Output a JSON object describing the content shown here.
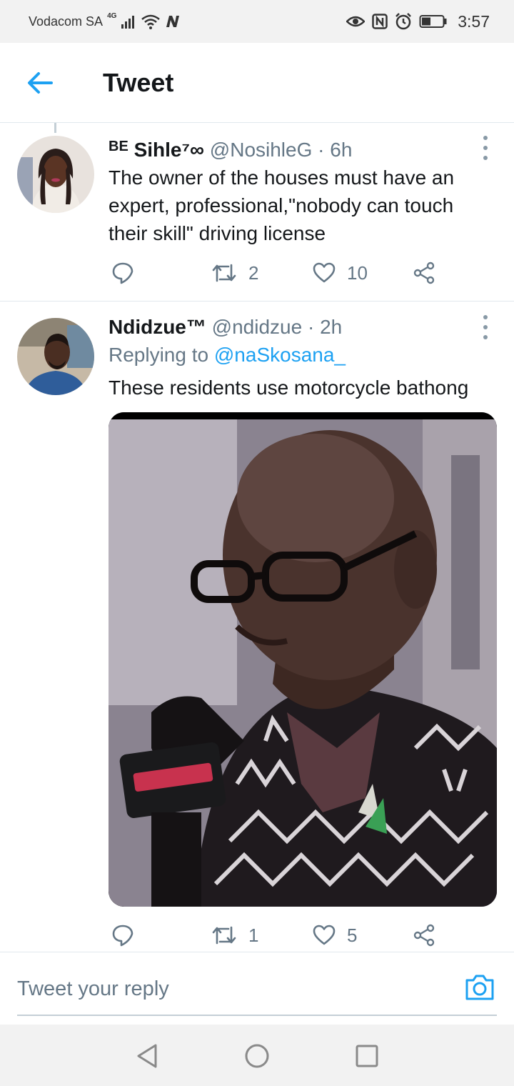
{
  "status_bar": {
    "carrier": "Vodacom SA",
    "network": "4G",
    "time": "3:57",
    "icons": [
      "signal-icon",
      "wifi-icon",
      "n-app-icon",
      "eye-icon",
      "nfc-icon",
      "alarm-icon",
      "battery-icon"
    ]
  },
  "header": {
    "title": "Tweet",
    "back_icon": "back-arrow-icon",
    "accent": "#1da1f2"
  },
  "tweets": [
    {
      "name_prefix": "BE",
      "name": "Sihle⁷∞",
      "handle": "@NosihleG",
      "separator": "·",
      "age": "6h",
      "text": "The owner of the houses must have an expert, professional,\"nobody can touch their skill\" driving license",
      "reply_count": "",
      "retweet_count": "2",
      "like_count": "10"
    },
    {
      "name": "Ndidzue™",
      "handle": "@ndidzue",
      "separator": "·",
      "age": "2h",
      "replying_prefix": "Replying to",
      "replying_to": "@naSkosana_",
      "text": "These residents use motorcycle bathong",
      "reply_count": "",
      "retweet_count": "1",
      "like_count": "5"
    }
  ],
  "reply_bar": {
    "placeholder": "Tweet your reply",
    "camera_icon": "camera-icon"
  },
  "nav_bar": {
    "buttons": [
      "nav-back-icon",
      "nav-home-icon",
      "nav-recents-icon"
    ]
  }
}
